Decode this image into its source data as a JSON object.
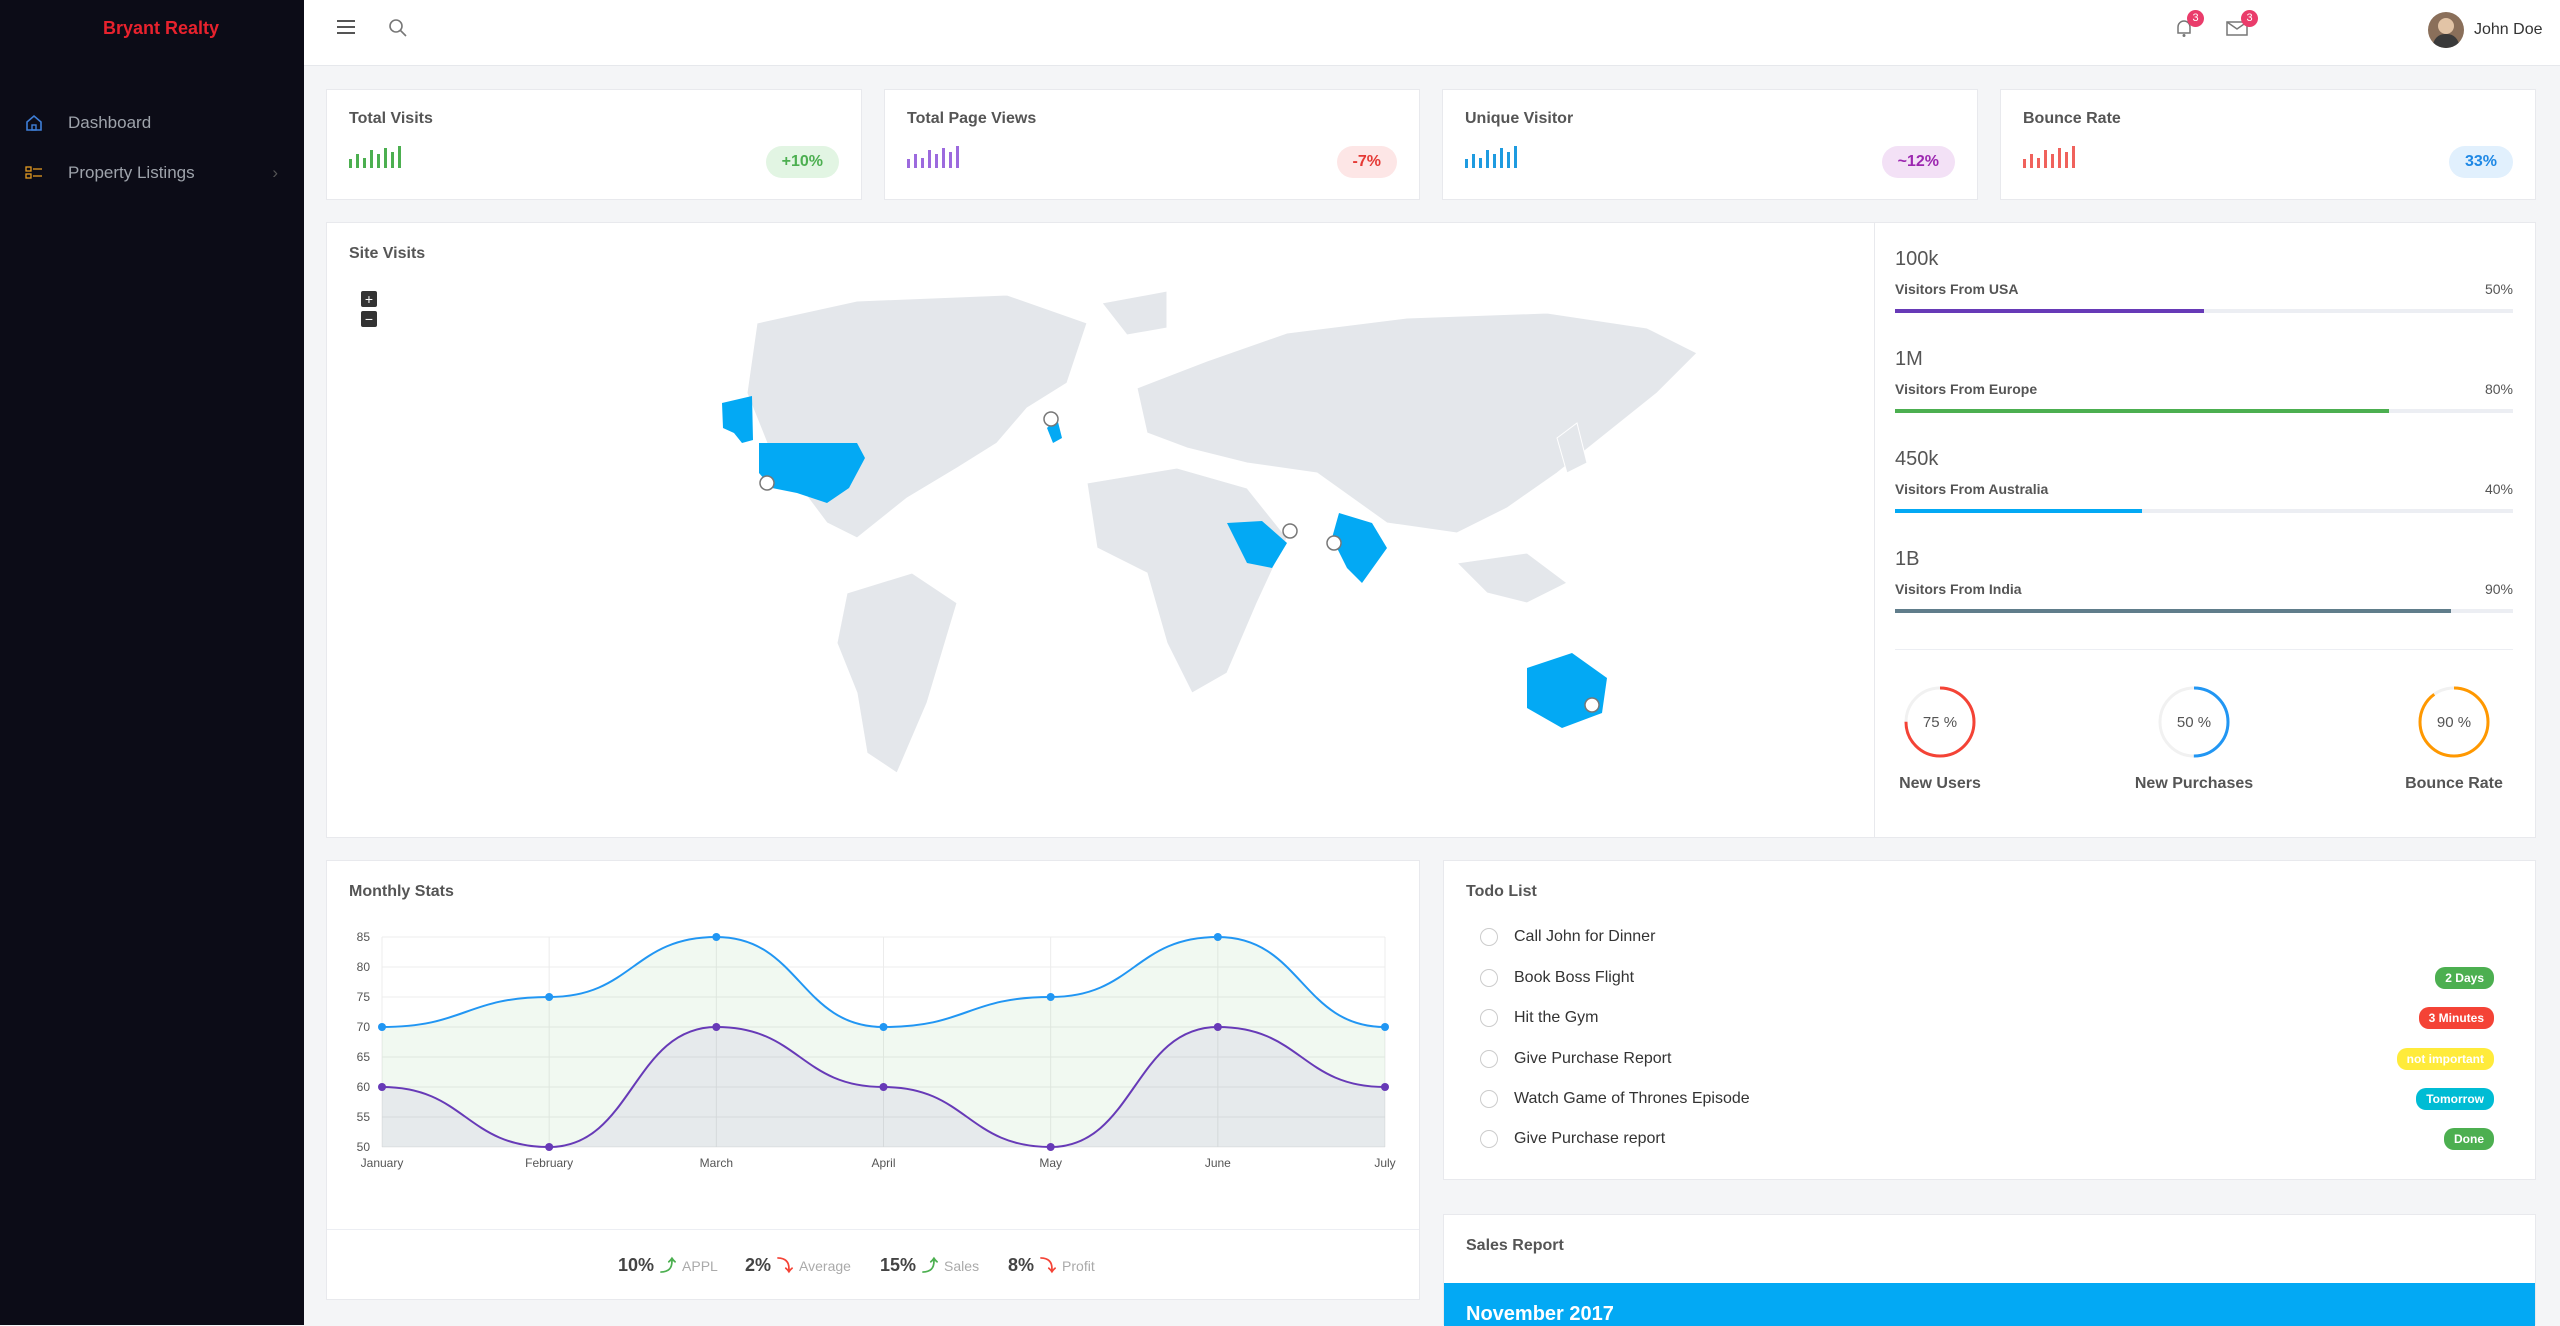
{
  "app": {
    "brand": "Bryant Realty"
  },
  "sidebar": {
    "items": [
      {
        "label": "Dashboard",
        "icon": "home-icon"
      },
      {
        "label": "Property Listings",
        "icon": "listing-icon"
      }
    ]
  },
  "header": {
    "notifications_count": "3",
    "messages_count": "3",
    "user_name": "John Doe"
  },
  "stat_cards": [
    {
      "title": "Total Visits",
      "change": "+10%",
      "color": "#4caf50",
      "bg": "#e2f5e3"
    },
    {
      "title": "Total Page Views",
      "change": "-7%",
      "color": "#e53935",
      "bg": "#fde6e6"
    },
    {
      "title": "Unique Visitor",
      "change": "~12%",
      "color": "#9c27b0",
      "bg": "#f3e1f6"
    },
    {
      "title": "Bounce Rate",
      "change": "33%",
      "color": "#1e88e5",
      "bg": "#e1f0fd"
    }
  ],
  "site_visits": {
    "title": "Site Visits",
    "zoom_in": "+",
    "zoom_out": "−"
  },
  "visitors": [
    {
      "count": "100k",
      "label": "Visitors From USA",
      "percent": "50%",
      "value": 50,
      "color": "#673ab7"
    },
    {
      "count": "1M",
      "label": "Visitors From Europe",
      "percent": "80%",
      "value": 80,
      "color": "#4caf50"
    },
    {
      "count": "450k",
      "label": "Visitors From Australia",
      "percent": "40%",
      "value": 40,
      "color": "#03a9f4"
    },
    {
      "count": "1B",
      "label": "Visitors From India",
      "percent": "90%",
      "value": 90,
      "color": "#607d8b"
    }
  ],
  "donuts": [
    {
      "text": "75 %",
      "label": "New Users",
      "value": 75,
      "color": "#f44336"
    },
    {
      "text": "50 %",
      "label": "New Purchases",
      "value": 50,
      "color": "#2196f3"
    },
    {
      "text": "90 %",
      "label": "Bounce Rate",
      "value": 90,
      "color": "#ff9800"
    }
  ],
  "monthly": {
    "title": "Monthly Stats",
    "stats": [
      {
        "value": "10%",
        "arrow": "⤴",
        "label": "APPL",
        "up": true
      },
      {
        "value": "2%",
        "arrow": "⤵",
        "label": "Average",
        "up": false
      },
      {
        "value": "15%",
        "arrow": "⤴",
        "label": "Sales",
        "up": true
      },
      {
        "value": "8%",
        "arrow": "⤵",
        "label": "Profit",
        "up": false
      }
    ]
  },
  "chart_data": {
    "type": "line",
    "categories": [
      "January",
      "February",
      "March",
      "April",
      "May",
      "June",
      "July"
    ],
    "series": [
      {
        "values": [
          70,
          75,
          85,
          70,
          75,
          85,
          70
        ],
        "color": "#2196f3"
      },
      {
        "values": [
          60,
          50,
          70,
          60,
          50,
          70,
          60
        ],
        "color": "#673ab7"
      }
    ],
    "yticks": [
      50,
      55,
      60,
      65,
      70,
      75,
      80,
      85
    ],
    "ylim": [
      50,
      85
    ],
    "grid": true
  },
  "todo": {
    "title": "Todo List",
    "items": [
      {
        "text": "Call John for Dinner",
        "tag": "",
        "color": ""
      },
      {
        "text": "Book Boss Flight",
        "tag": "2 Days",
        "color": "#4caf50"
      },
      {
        "text": "Hit the Gym",
        "tag": "3 Minutes",
        "color": "#f44336"
      },
      {
        "text": "Give Purchase Report",
        "tag": "not important",
        "color": "#ffeb3b"
      },
      {
        "text": "Watch Game of Thrones Episode",
        "tag": "Tomorrow",
        "color": "#00bcd4"
      },
      {
        "text": "Give Purchase report",
        "tag": "Done",
        "color": "#4caf50"
      }
    ]
  },
  "sales": {
    "title": "Sales Report",
    "month": "November 2017"
  }
}
